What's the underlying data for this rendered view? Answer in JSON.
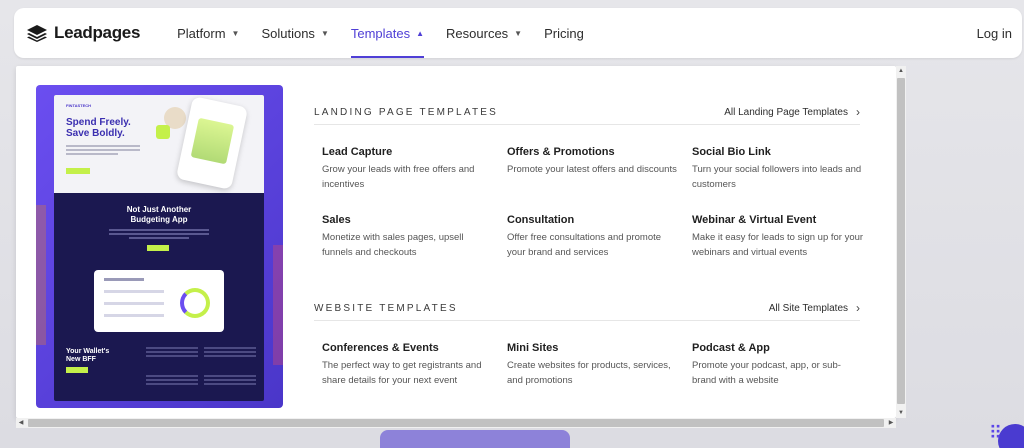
{
  "brand": {
    "name": "Leadpages"
  },
  "nav": {
    "items": [
      {
        "label": "Platform",
        "caret": "▼"
      },
      {
        "label": "Solutions",
        "caret": "▼"
      },
      {
        "label": "Templates",
        "caret": "▲"
      },
      {
        "label": "Resources",
        "caret": "▼"
      },
      {
        "label": "Pricing",
        "caret": ""
      }
    ],
    "login": "Log in"
  },
  "preview": {
    "logo": "FINTASTECH",
    "headline_1": "Spend Freely.",
    "headline_2": "Save Boldly.",
    "mid_title_1": "Not Just Another",
    "mid_title_2": "Budgeting App",
    "bottom_title_1": "Your Wallet's",
    "bottom_title_2": "New BFF"
  },
  "landing": {
    "title": "LANDING PAGE TEMPLATES",
    "link": "All Landing Page Templates",
    "items": [
      {
        "title": "Lead Capture",
        "desc": "Grow your leads with free offers and incentives"
      },
      {
        "title": "Offers & Promotions",
        "desc": "Promote your latest offers and discounts"
      },
      {
        "title": "Social Bio Link",
        "desc": "Turn your social followers into leads and customers"
      },
      {
        "title": "Sales",
        "desc": "Monetize with sales pages, upsell funnels and checkouts"
      },
      {
        "title": "Consultation",
        "desc": "Offer free consultations and promote your brand and services"
      },
      {
        "title": "Webinar & Virtual Event",
        "desc": "Make it easy for leads to sign up for your webinars and virtual events"
      }
    ]
  },
  "website": {
    "title": "WEBSITE TEMPLATES",
    "link": "All Site Templates",
    "items": [
      {
        "title": "Conferences & Events",
        "desc": "The perfect way to get registrants and share details for your next event"
      },
      {
        "title": "Mini Sites",
        "desc": "Create websites for products, services, and promotions"
      },
      {
        "title": "Podcast & App",
        "desc": "Promote your podcast, app, or sub-brand with a website"
      }
    ]
  },
  "colors": {
    "accent": "#4f3fd6",
    "lime": "#c4f04a",
    "navy": "#1b1850"
  },
  "icons": {
    "chevron": "chevron-right-icon",
    "caret": "caret-down-icon"
  }
}
